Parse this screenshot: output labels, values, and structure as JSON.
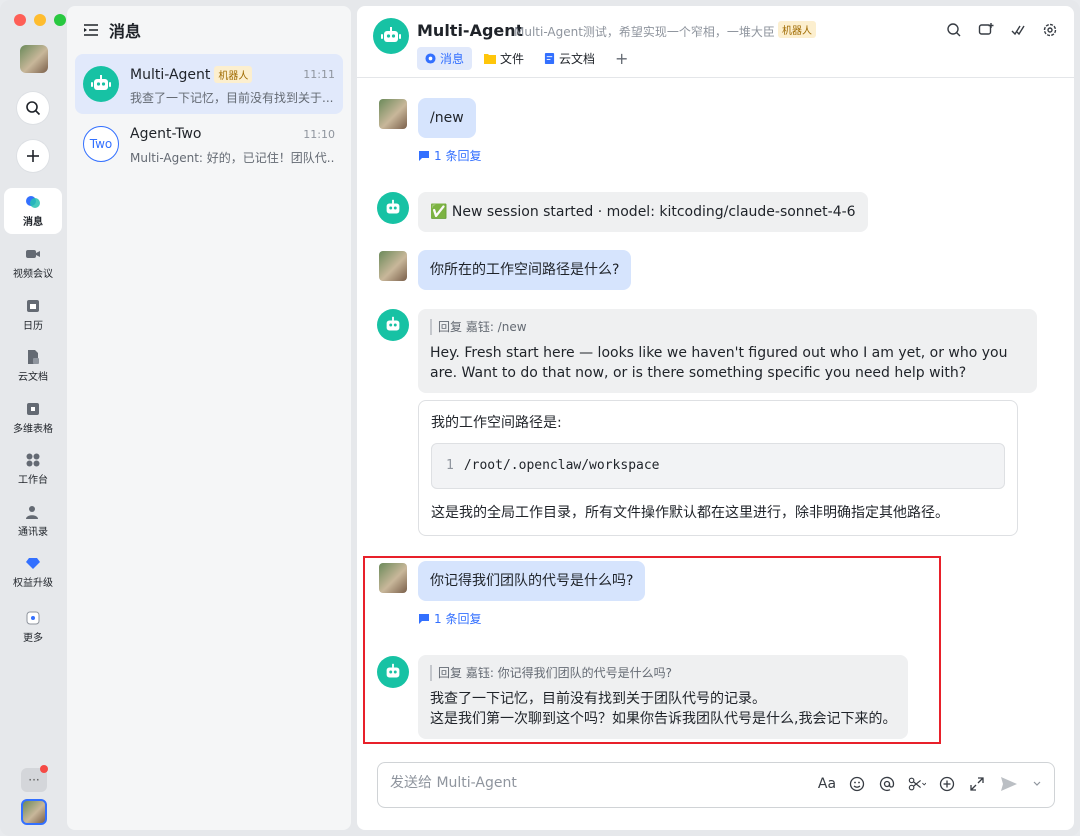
{
  "rail": {
    "items": [
      {
        "label": "消息",
        "icon": "message-icon"
      },
      {
        "label": "视频会议",
        "icon": "video-icon"
      },
      {
        "label": "日历",
        "icon": "calendar-icon"
      },
      {
        "label": "云文档",
        "icon": "doc-icon"
      },
      {
        "label": "多维表格",
        "icon": "table-icon"
      },
      {
        "label": "工作台",
        "icon": "apps-icon"
      },
      {
        "label": "通讯录",
        "icon": "contacts-icon"
      },
      {
        "label": "权益升级",
        "icon": "diamond-icon"
      },
      {
        "label": "更多",
        "icon": "more-icon"
      }
    ],
    "more_label": "···"
  },
  "list": {
    "title": "消息",
    "chats": [
      {
        "name": "Multi-Agent",
        "tag": "机器人",
        "time": "11:11",
        "preview": "我查了一下记忆，目前没有找到关于..."
      },
      {
        "name": "Agent-Two",
        "avatar_text": "Two",
        "time": "11:10",
        "preview": "Multi-Agent: 好的，已记住！团队代..."
      }
    ]
  },
  "header": {
    "title": "Multi-Agent",
    "desc": "Multi-Agent测试，希望实现一个窄相，一堆大臣",
    "tag": "机器人",
    "tabs": [
      {
        "label": "消息",
        "icon": "message-icon"
      },
      {
        "label": "文件",
        "icon": "folder-icon"
      },
      {
        "label": "云文档",
        "icon": "doc-icon"
      }
    ],
    "add_tab": "+"
  },
  "messages": {
    "m1": {
      "text": "/new",
      "reply_count": "1 条回复"
    },
    "m2": {
      "text": "✅ New session started · model: kitcoding/claude-sonnet-4-6"
    },
    "m3": {
      "text": "你所在的工作空间路径是什么?"
    },
    "m4": {
      "quote": "回复 嘉钰: /new",
      "text": "Hey. Fresh start here — looks like we haven't figured out who I am yet, or who you are. Want to do that now, or is there something specific you need help with?"
    },
    "m5": {
      "intro": "我的工作空间路径是:",
      "code_line": "1",
      "code": "/root/.openclaw/workspace",
      "outro": "这是我的全局工作目录，所有文件操作默认都在这里进行，除非明确指定其他路径。"
    },
    "m6": {
      "text": "你记得我们团队的代号是什么吗?",
      "reply_count": "1 条回复"
    },
    "m7": {
      "quote": "回复 嘉钰: 你记得我们团队的代号是什么吗?",
      "line1": "我查了一下记忆，目前没有找到关于团队代号的记录。",
      "line2": "这是我们第一次聊到这个吗？如果你告诉我团队代号是什么,我会记下来的。"
    }
  },
  "composer": {
    "placeholder": "发送给 Multi-Agent",
    "font_label": "Aa"
  }
}
